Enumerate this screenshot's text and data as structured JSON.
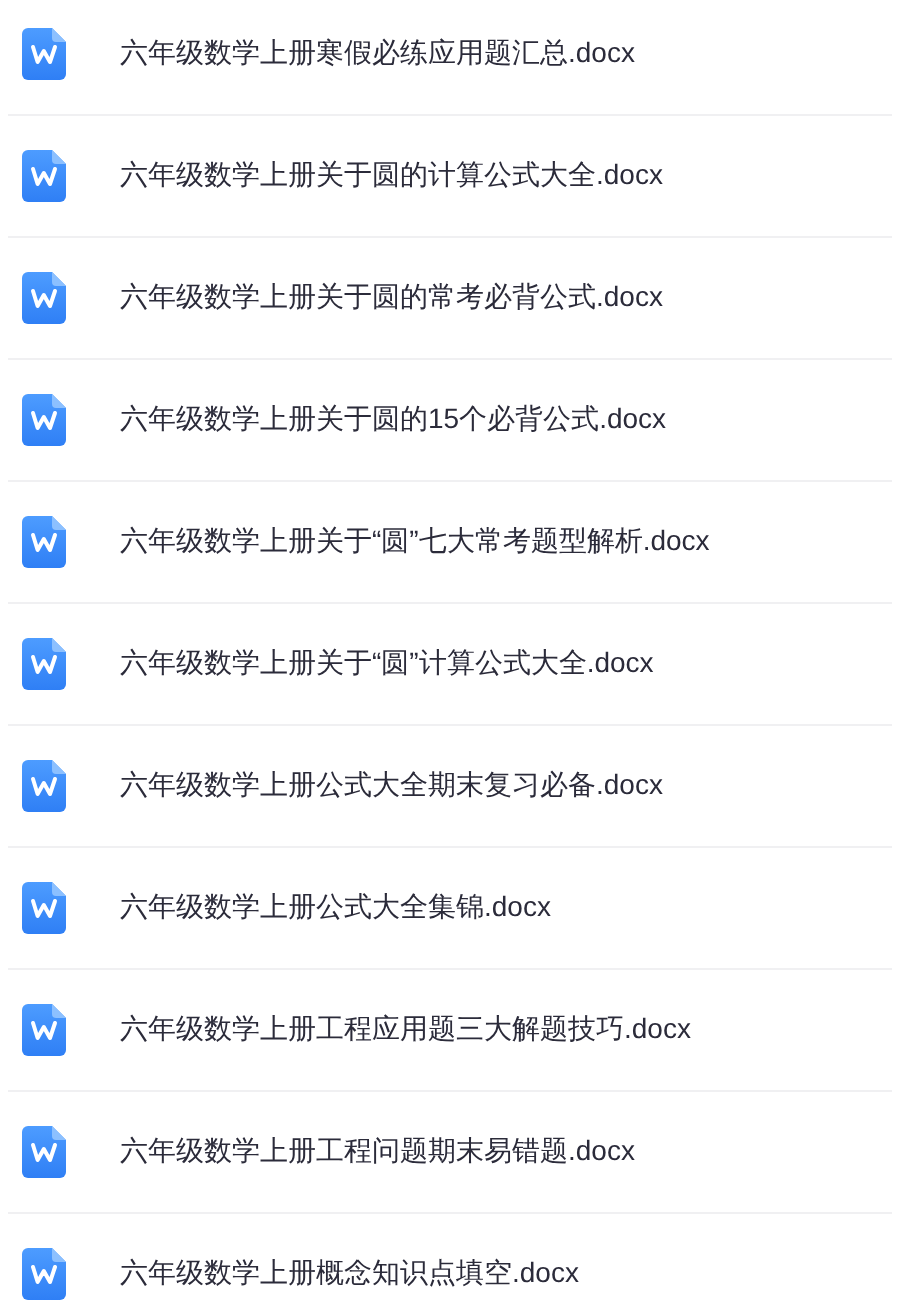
{
  "files": [
    {
      "name": "六年级数学上册寒假必练应用题汇总.docx"
    },
    {
      "name": "六年级数学上册关于圆的计算公式大全.docx"
    },
    {
      "name": "六年级数学上册关于圆的常考必背公式.docx"
    },
    {
      "name": "六年级数学上册关于圆的15个必背公式.docx"
    },
    {
      "name": "六年级数学上册关于“圆”七大常考题型解析.docx"
    },
    {
      "name": "六年级数学上册关于“圆”计算公式大全.docx"
    },
    {
      "name": "六年级数学上册公式大全期末复习必备.docx"
    },
    {
      "name": "六年级数学上册公式大全集锦.docx"
    },
    {
      "name": "六年级数学上册工程应用题三大解题技巧.docx"
    },
    {
      "name": "六年级数学上册工程问题期末易错题.docx"
    },
    {
      "name": "六年级数学上册概念知识点填空.docx"
    }
  ]
}
